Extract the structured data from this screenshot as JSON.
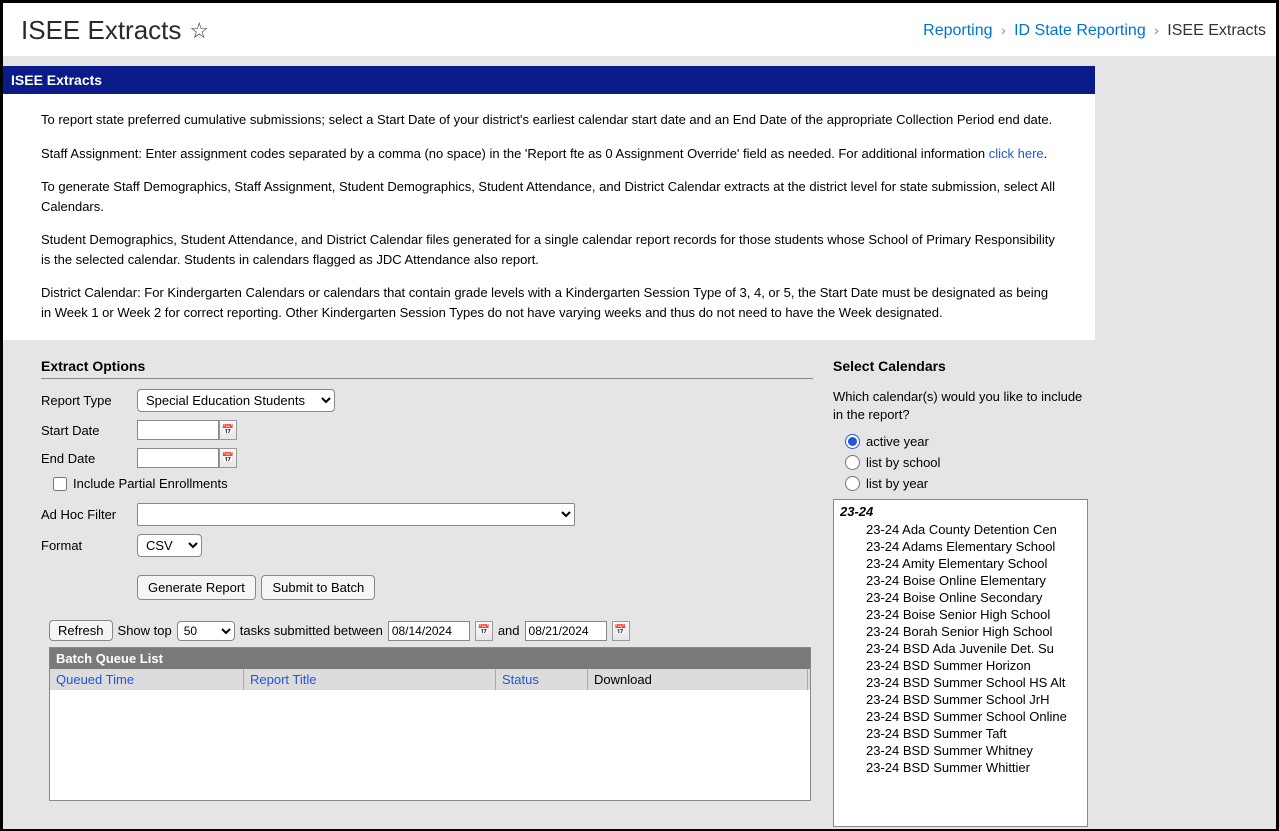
{
  "pageTitle": "ISEE Extracts",
  "breadcrumbs": {
    "items": [
      "Reporting",
      "ID State Reporting"
    ],
    "current": "ISEE Extracts"
  },
  "panelHeader": "ISEE Extracts",
  "intro": {
    "p1": "To report state preferred cumulative submissions; select a Start Date of your district's earliest calendar start date and an End Date of the appropriate Collection Period end date.",
    "p2a": "Staff Assignment: Enter assignment codes separated by a comma (no space) in the 'Report fte as 0 Assignment Override' field as needed. For additional information ",
    "p2link": "click here",
    "p3": "To generate Staff Demographics, Staff Assignment, Student Demographics, Student Attendance, and District Calendar extracts at the district level for state submission, select All Calendars.",
    "p4": "Student Demographics, Student Attendance, and District Calendar files generated for a single calendar report records for those students whose School of Primary Responsibility is the selected calendar. Students in calendars flagged as JDC Attendance also report.",
    "p5": "District Calendar: For Kindergarten Calendars or calendars that contain grade levels with a Kindergarten Session Type of 3, 4, or 5, the Start Date must be designated as being in Week 1 or Week 2 for correct reporting. Other Kindergarten Session Types do not have varying weeks and thus do not need to have the Week designated."
  },
  "extractOptions": {
    "title": "Extract Options",
    "reportTypeLbl": "Report Type",
    "reportTypeVal": "Special Education Students",
    "startDateLbl": "Start Date",
    "endDateLbl": "End Date",
    "includePartialLbl": "Include Partial Enrollments",
    "adHocLbl": "Ad Hoc Filter",
    "formatLbl": "Format",
    "formatVal": "CSV",
    "generateBtn": "Generate Report",
    "submitBtn": "Submit to Batch"
  },
  "batch": {
    "refresh": "Refresh",
    "showTop": "Show top",
    "topValue": "50",
    "tasksBetween": "tasks submitted between",
    "date1": "08/14/2024",
    "and": "and",
    "date2": "08/21/2024",
    "tableTitle": "Batch Queue List",
    "cols": {
      "c1": "Queued Time",
      "c2": "Report Title",
      "c3": "Status",
      "c4": "Download"
    }
  },
  "selectCalendars": {
    "title": "Select Calendars",
    "desc": "Which calendar(s) would you like to include in the report?",
    "radios": {
      "r1": "active year",
      "r2": "list by school",
      "r3": "list by year"
    },
    "yearHeader": "23-24",
    "items": [
      "23-24 Ada County Detention Cen",
      "23-24 Adams Elementary School",
      "23-24 Amity Elementary School",
      "23-24 Boise Online Elementary",
      "23-24 Boise Online Secondary",
      "23-24 Boise Senior High School",
      "23-24 Borah Senior High School",
      "23-24 BSD Ada Juvenile Det. Su",
      "23-24 BSD Summer Horizon",
      "23-24 BSD Summer School HS Alt",
      "23-24 BSD Summer School JrH",
      "23-24 BSD Summer School Online",
      "23-24 BSD Summer Taft",
      "23-24 BSD Summer Whitney",
      "23-24 BSD Summer Whittier"
    ]
  }
}
